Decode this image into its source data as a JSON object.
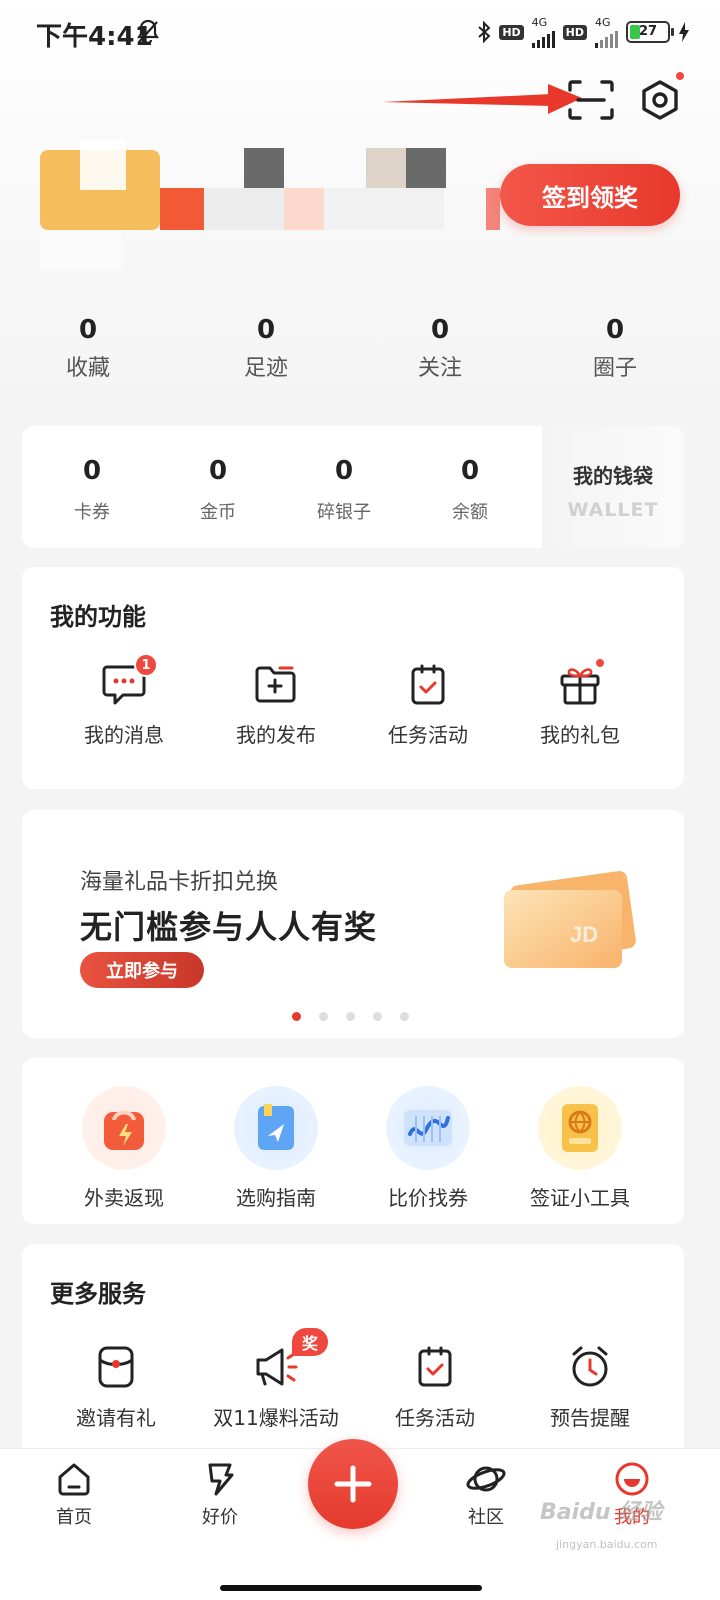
{
  "status_bar": {
    "time": "下午4:41",
    "hd1": "HD",
    "net1": "4G",
    "hd2": "HD",
    "net2": "4G",
    "battery": "27",
    "battery_level": 0.27
  },
  "header": {
    "scan_icon": "scan-icon",
    "settings_icon": "settings-hexagon-icon",
    "annotation": "red-arrow-pointing-to-scan"
  },
  "profile": {
    "signin_label": "签到领奖"
  },
  "stats": [
    {
      "value": "0",
      "label": "收藏"
    },
    {
      "value": "0",
      "label": "足迹"
    },
    {
      "value": "0",
      "label": "关注"
    },
    {
      "value": "0",
      "label": "圈子"
    }
  ],
  "wallet": {
    "items": [
      {
        "value": "0",
        "label": "卡券"
      },
      {
        "value": "0",
        "label": "金币"
      },
      {
        "value": "0",
        "label": "碎银子"
      },
      {
        "value": "0",
        "label": "余额"
      }
    ],
    "title": "我的钱袋",
    "subtitle": "WALLET"
  },
  "functions": {
    "title": "我的功能",
    "items": [
      {
        "label": "我的消息",
        "icon": "message-icon",
        "badge": "1"
      },
      {
        "label": "我的发布",
        "icon": "publish-folder-icon"
      },
      {
        "label": "任务活动",
        "icon": "task-clipboard-icon"
      },
      {
        "label": "我的礼包",
        "icon": "gift-icon"
      }
    ]
  },
  "banner": {
    "subtitle": "海量礼品卡折扣兑换",
    "title": "无门槛参与人人有奖",
    "button": "立即参与",
    "card_text": "JD",
    "dot_count": 5,
    "active_dot": 0
  },
  "tools": {
    "items": [
      {
        "label": "外卖返现",
        "icon": "takeout-bag-icon"
      },
      {
        "label": "选购指南",
        "icon": "guide-book-icon"
      },
      {
        "label": "比价找券",
        "icon": "price-chart-icon"
      },
      {
        "label": "签证小工具",
        "icon": "passport-icon"
      }
    ]
  },
  "more": {
    "title": "更多服务",
    "items": [
      {
        "label": "邀请有礼",
        "icon": "red-envelope-icon"
      },
      {
        "label": "双11爆料活动",
        "icon": "megaphone-icon",
        "badge": "奖"
      },
      {
        "label": "任务活动",
        "icon": "task-clipboard-icon"
      },
      {
        "label": "预告提醒",
        "icon": "alarm-clock-icon"
      }
    ]
  },
  "bottom_nav": {
    "items": [
      {
        "label": "首页",
        "icon": "home-icon"
      },
      {
        "label": "好价",
        "icon": "deal-icon"
      },
      {
        "label": "社区",
        "icon": "planet-icon"
      },
      {
        "label": "我的",
        "icon": "profile-icon",
        "active": true
      }
    ],
    "plus_icon": "plus-icon"
  },
  "watermark": {
    "text": "Baidu 经验",
    "sub": "jingyan.baidu.com"
  },
  "colors": {
    "accent": "#e8382c",
    "page_bg": "#f4f4f5",
    "card_bg": "#ffffff"
  }
}
